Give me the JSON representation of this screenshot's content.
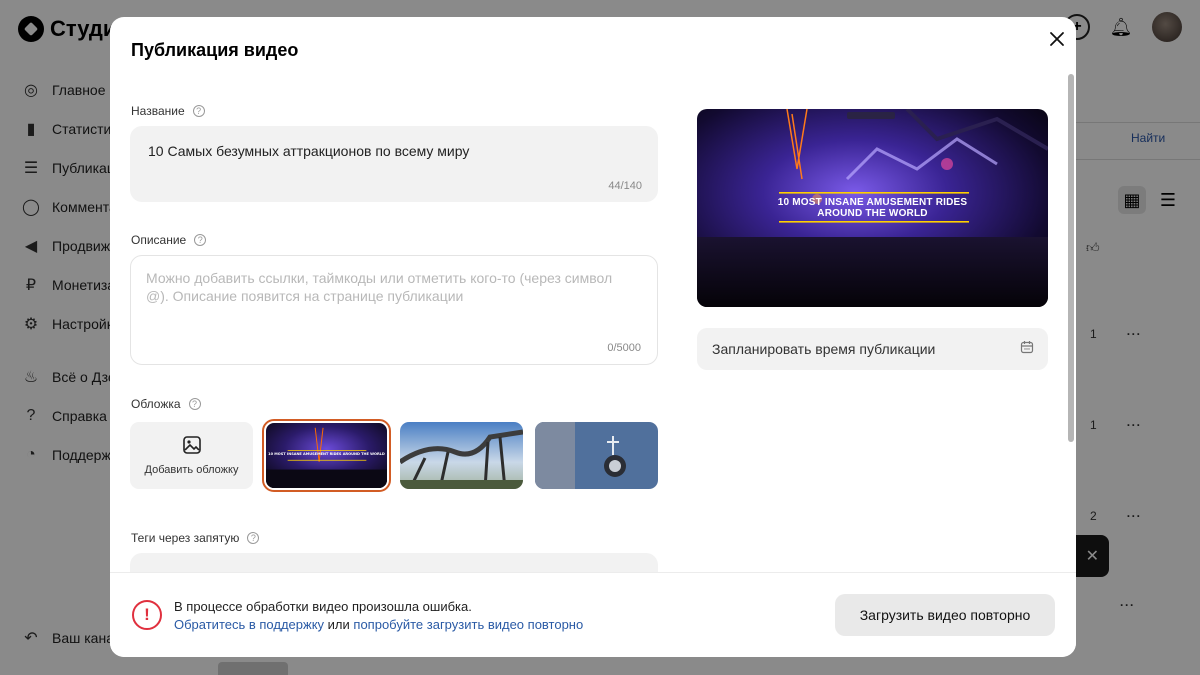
{
  "background": {
    "logo_text": "Студия",
    "nav_items": [
      {
        "label": "Главное",
        "icon": "planet-icon",
        "glyph": "◎"
      },
      {
        "label": "Статисти",
        "icon": "chart-icon",
        "glyph": "▮"
      },
      {
        "label": "Публикац",
        "icon": "publications-icon",
        "glyph": "☰"
      },
      {
        "label": "Коммента",
        "icon": "comment-icon",
        "glyph": "◯"
      },
      {
        "label": "Продвиже",
        "icon": "megaphone-icon",
        "glyph": "◀"
      },
      {
        "label": "Монетиза",
        "icon": "ruble-icon",
        "glyph": "₽"
      },
      {
        "label": "Настройк",
        "icon": "gear-icon",
        "glyph": "⚙"
      }
    ],
    "nav_items_secondary": [
      {
        "label": "Всё о Дзе",
        "icon": "flame-icon",
        "glyph": "♨"
      },
      {
        "label": "Справка",
        "icon": "help-circle-icon",
        "glyph": "?"
      },
      {
        "label": "Поддерж",
        "icon": "chat-icon",
        "glyph": "◔"
      }
    ],
    "nav_bottom_label": "Ваш кана",
    "find_label": "Найти",
    "row_counts": [
      "1",
      "1",
      "2"
    ]
  },
  "modal": {
    "title": "Публикация видео",
    "name_field": {
      "label": "Название",
      "value": "10 Самых безумных аттракционов по всему миру",
      "counter": "44/140"
    },
    "description_field": {
      "label": "Описание",
      "placeholder": "Можно добавить ссылки, таймкоды или отметить кого-то (через символ @). Описание появится на странице публикации",
      "counter": "0/5000"
    },
    "cover": {
      "label": "Обложка",
      "add_label": "Добавить обложку",
      "thumb_caption": "10 MOST INSANE AMUSEMENT RIDES AROUND THE WORLD"
    },
    "tags_field": {
      "label": "Теги через запятую"
    },
    "preview": {
      "caption_line1": "10 MOST INSANE AMUSEMENT RIDES",
      "caption_line2": "AROUND THE WORLD"
    },
    "schedule_label": "Запланировать время публикации",
    "footer": {
      "error_text": "В процессе обработки видео произошла ошибка.",
      "link_support": "Обратитесь в поддержку",
      "link_or": "или",
      "link_retry": "попробуйте загрузить видео повторно",
      "retry_button": "Загрузить видео повторно"
    }
  },
  "colors": {
    "accent_link": "#2a5aa5",
    "error": "#e0303e",
    "selected_outline": "#d25c24"
  }
}
